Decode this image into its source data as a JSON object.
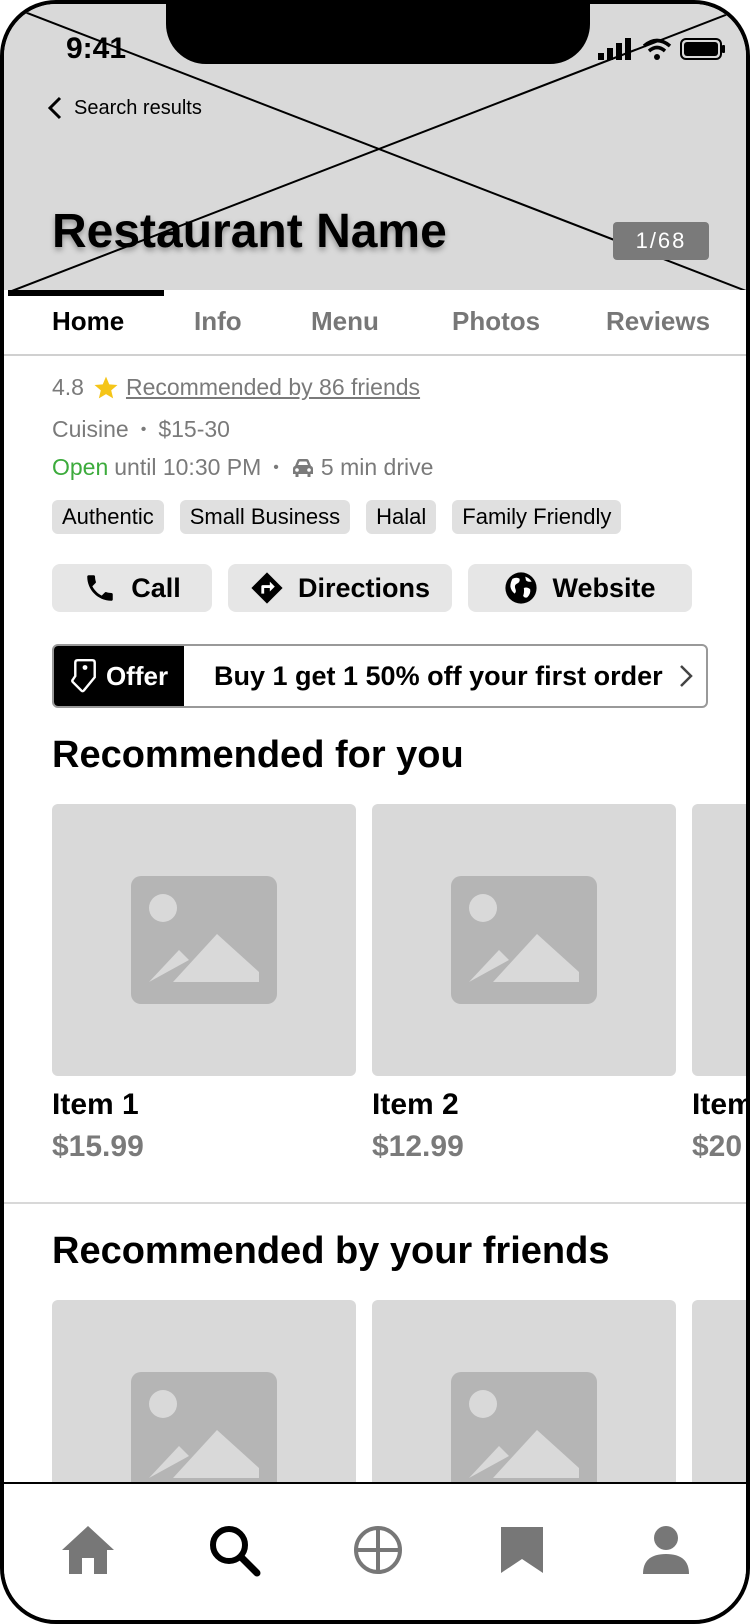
{
  "status_bar": {
    "time": "9:41"
  },
  "header": {
    "back_label": "Search results",
    "restaurant_name": "Restaurant Name",
    "photo_counter": "1/68"
  },
  "tabs": [
    {
      "label": "Home",
      "active": true
    },
    {
      "label": "Info",
      "active": false
    },
    {
      "label": "Menu",
      "active": false
    },
    {
      "label": "Photos",
      "active": false
    },
    {
      "label": "Reviews",
      "active": false
    }
  ],
  "info": {
    "rating": "4.8",
    "recommended": "Recommended by 86 friends",
    "cuisine": "Cuisine",
    "price_range": "$15-30",
    "open_status": "Open",
    "hours": "until 10:30 PM",
    "drive_time": "5 min drive"
  },
  "tags": [
    "Authentic",
    "Small Business",
    "Halal",
    "Family Friendly"
  ],
  "actions": {
    "call": "Call",
    "directions": "Directions",
    "website": "Website"
  },
  "offer": {
    "badge": "Offer",
    "text": "Buy 1 get 1 50% off your first order"
  },
  "recommended_for_you": {
    "title": "Recommended for you",
    "items": [
      {
        "name": "Item 1",
        "price": "$15.99"
      },
      {
        "name": "Item 2",
        "price": "$12.99"
      },
      {
        "name": "Item",
        "price": "$20"
      }
    ]
  },
  "recommended_by_friends": {
    "title": "Recommended by your friends"
  },
  "bottom_nav": [
    "home-icon",
    "search-icon",
    "explore-icon",
    "bookmark-icon",
    "profile-icon"
  ],
  "colors": {
    "open_green": "#3cab3c",
    "placeholder": "#d9d9d9",
    "muted_text": "#7a7a7a"
  }
}
